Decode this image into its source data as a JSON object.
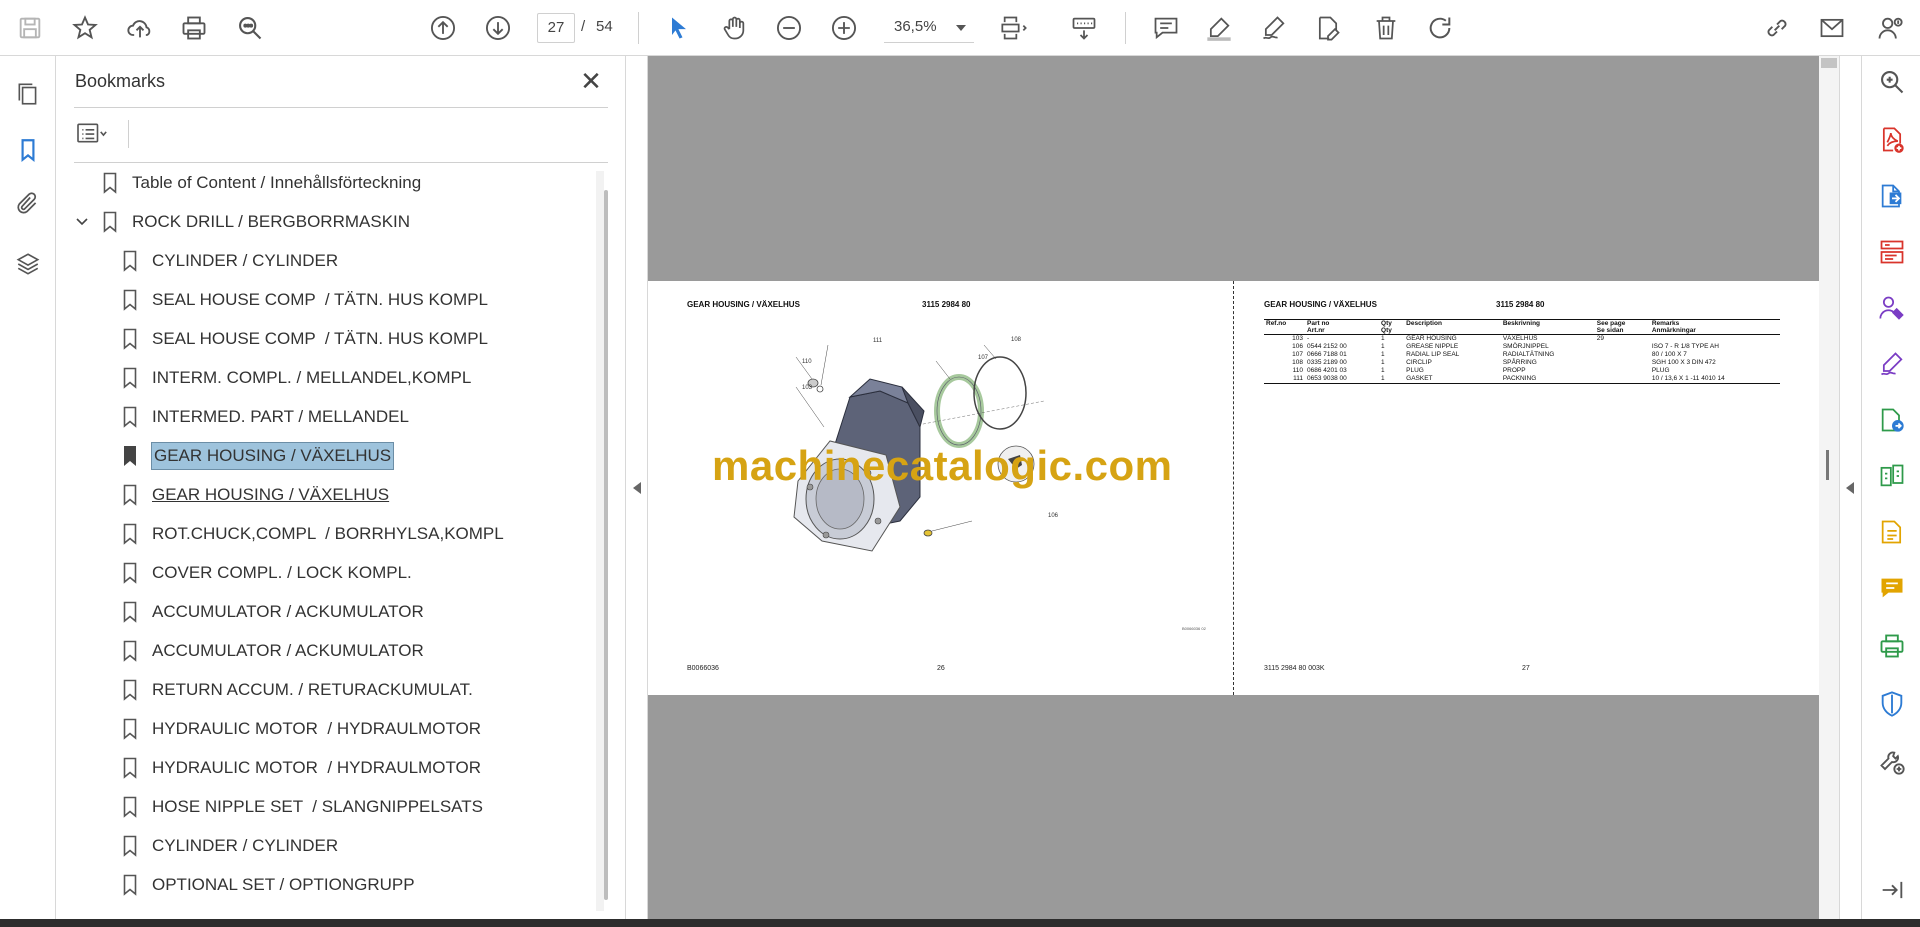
{
  "toolbar": {
    "current_page": "27",
    "page_separator": "/",
    "total_pages": "54",
    "zoom": "36,5%"
  },
  "bookmarks": {
    "title": "Bookmarks",
    "items": [
      {
        "label": "Table of Content / Innehållsförteckning",
        "level": 0
      },
      {
        "label": "ROCK DRILL / BERGBORRMASKIN",
        "level": 0,
        "expanded": true
      },
      {
        "label": "CYLINDER / CYLINDER",
        "level": 1
      },
      {
        "label": "SEAL HOUSE COMP  / TÄTN. HUS KOMPL",
        "level": 1
      },
      {
        "label": "SEAL HOUSE COMP  / TÄTN. HUS KOMPL",
        "level": 1
      },
      {
        "label": "INTERM. COMPL. / MELLANDEL,KOMPL",
        "level": 1
      },
      {
        "label": "INTERMED. PART / MELLANDEL",
        "level": 1
      },
      {
        "label": "GEAR HOUSING / VÄXELHUS",
        "level": 1,
        "selected": true
      },
      {
        "label": "GEAR HOUSING / VÄXELHUS",
        "level": 1,
        "hover": true
      },
      {
        "label": "ROT.CHUCK,COMPL  / BORRHYLSA,KOMPL",
        "level": 1
      },
      {
        "label": "COVER COMPL. / LOCK KOMPL.",
        "level": 1
      },
      {
        "label": "ACCUMULATOR / ACKUMULATOR",
        "level": 1
      },
      {
        "label": "ACCUMULATOR / ACKUMULATOR",
        "level": 1
      },
      {
        "label": "RETURN ACCUM. / RETURACKUMULAT.",
        "level": 1
      },
      {
        "label": "HYDRAULIC MOTOR  / HYDRAULMOTOR",
        "level": 1
      },
      {
        "label": "HYDRAULIC MOTOR  / HYDRAULMOTOR",
        "level": 1
      },
      {
        "label": "HOSE NIPPLE SET  / SLANGNIPPELSATS",
        "level": 1
      },
      {
        "label": "CYLINDER / CYLINDER",
        "level": 1
      },
      {
        "label": "OPTIONAL SET / OPTIONGRUPP",
        "level": 1
      }
    ]
  },
  "document": {
    "left_page": {
      "title": "GEAR HOUSING / VÄXELHUS",
      "part_no": "3115 2984 80",
      "footer_code": "B0066036",
      "page_number": "26",
      "image_ref": "B0066036 02",
      "callouts": [
        "111",
        "110",
        "103",
        "107",
        "108",
        "106"
      ]
    },
    "right_page": {
      "title": "GEAR HOUSING / VÄXELHUS",
      "part_no": "3115 2984 80",
      "footer_code": "3115 2984 80 003K",
      "page_number": "27",
      "table": {
        "headers": [
          [
            "Ref.no",
            ""
          ],
          [
            "Part no",
            "Art.nr"
          ],
          [
            "Qty",
            "Qty"
          ],
          [
            "Description",
            ""
          ],
          [
            "Beskrivning",
            ""
          ],
          [
            "See page",
            "Se sidan"
          ],
          [
            "Remarks",
            "Anmärkningar"
          ]
        ],
        "rows": [
          [
            "103",
            "-",
            "1",
            "GEAR HOUSING",
            "VÄXELHUS",
            "29",
            ""
          ],
          [
            "106",
            "0544 2152 00",
            "1",
            "GREASE NIPPLE",
            "SMÖRJNIPPEL",
            "",
            "ISO 7 - R 1/8 TYPE AH"
          ],
          [
            "107",
            "0666 7188 01",
            "1",
            "RADIAL LIP SEAL",
            "RADIALTÄTNING",
            "",
            "80 / 100 X 7"
          ],
          [
            "108",
            "0335 2189 00",
            "1",
            "CIRCLIP",
            "SPÅRRING",
            "",
            "SGH 100 X 3 DIN 472"
          ],
          [
            "110",
            "0686 4201 03",
            "1",
            "PLUG",
            "PROPP",
            "",
            "PLUG"
          ],
          [
            "111",
            "0653 9038 00",
            "1",
            "GASKET",
            "PACKNING",
            "",
            "10 / 13,6 X 1 -11 4010 14"
          ]
        ]
      }
    },
    "watermark": "machinecatalogic.com"
  },
  "icons": {
    "toolbar": [
      "save-icon",
      "star-icon",
      "upload-icon",
      "print-icon",
      "zoom-search-icon",
      "page-up-icon",
      "page-down-icon",
      "select-cursor-icon",
      "hand-icon",
      "zoom-out-icon",
      "zoom-in-icon",
      "page-fit-icon",
      "scroll-mode-icon",
      "comment-icon",
      "highlight-icon",
      "sign-icon",
      "edit-icon",
      "delete-icon",
      "rotate-icon",
      "link-icon",
      "email-icon",
      "account-icon"
    ],
    "left_rail": [
      "pages-icon",
      "bookmark-icon",
      "attachment-icon",
      "layers-icon"
    ],
    "right_rail": [
      "search-icon",
      "create-pdf-icon",
      "export-pdf-icon",
      "organize-icon",
      "request-sign-icon",
      "fill-sign-icon",
      "export-icon",
      "compare-icon",
      "edit-pdf-icon",
      "comment-icon",
      "print-production-icon",
      "protect-icon",
      "more-tools-icon",
      "expand-icon"
    ]
  },
  "colors": {
    "selection": "#9ec3dc",
    "watermark": "#d6a313",
    "accent_red": "#d9342b",
    "accent_purple": "#7a3cc4",
    "accent_blue": "#2d7bd4",
    "accent_green": "#2e9a4a",
    "accent_yellow": "#e2a400"
  }
}
